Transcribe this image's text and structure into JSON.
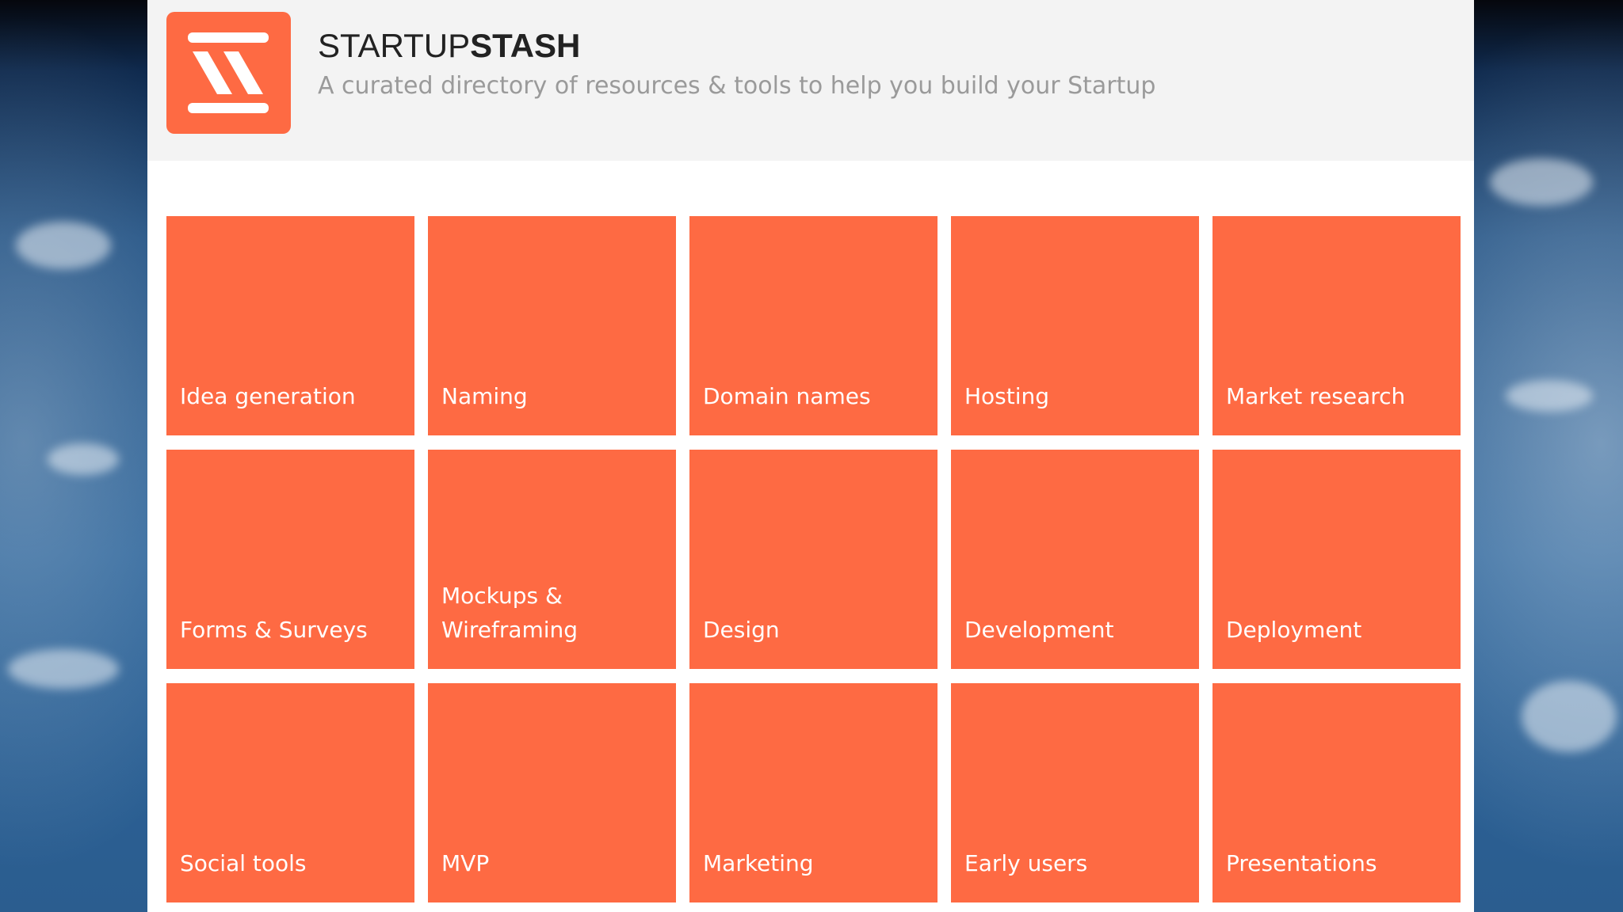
{
  "colors": {
    "accent": "#fe6a43",
    "header_bg": "#f3f3f3",
    "tagline": "#9a9a9a"
  },
  "header": {
    "logo_icon": "startupstash-logo-icon",
    "brand_light": "STARTUP",
    "brand_bold": "STASH",
    "tagline": "A curated directory of resources & tools to help you build your Startup"
  },
  "categories": [
    {
      "label": "Idea generation"
    },
    {
      "label": "Naming"
    },
    {
      "label": "Domain names"
    },
    {
      "label": "Hosting"
    },
    {
      "label": "Market research"
    },
    {
      "label": "Forms & Surveys"
    },
    {
      "label": "Mockups & Wireframing"
    },
    {
      "label": "Design"
    },
    {
      "label": "Development"
    },
    {
      "label": "Deployment"
    },
    {
      "label": "Social tools"
    },
    {
      "label": "MVP"
    },
    {
      "label": "Marketing"
    },
    {
      "label": "Early users"
    },
    {
      "label": "Presentations"
    }
  ]
}
